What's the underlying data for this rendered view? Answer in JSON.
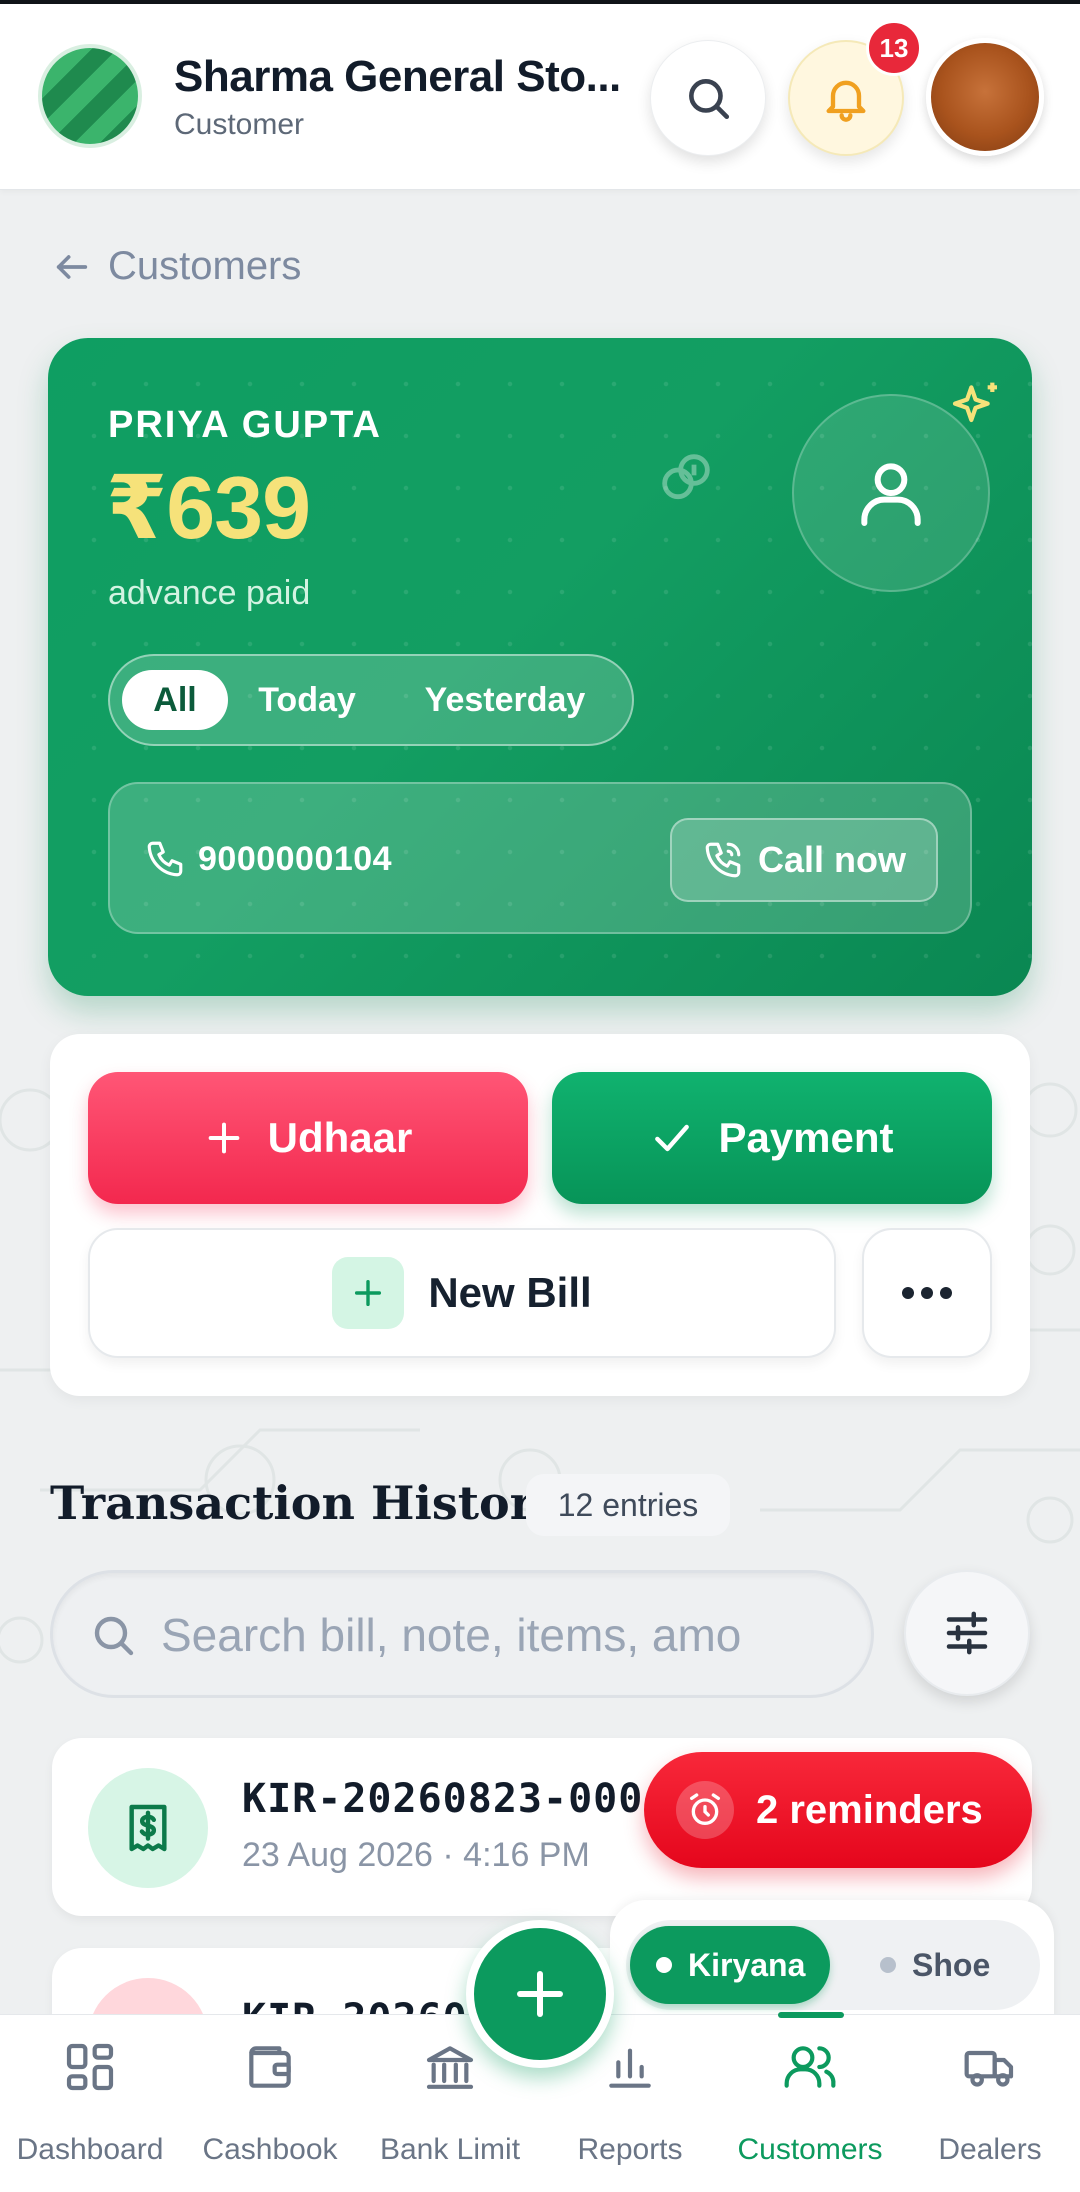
{
  "header": {
    "store_name": "Sharma General Sto...",
    "store_role": "Customer",
    "notification_count": "13"
  },
  "breadcrumb": {
    "back_label": "Customers"
  },
  "customer": {
    "name": "PRIYA GUPTA",
    "amount": "₹639",
    "status": "advance paid",
    "filters": [
      "All",
      "Today",
      "Yesterday"
    ],
    "active_filter": "All",
    "phone": "9000000104",
    "call_label": "Call now"
  },
  "actions": {
    "udhaar_label": "Udhaar",
    "payment_label": "Payment",
    "new_bill_label": "New Bill"
  },
  "history": {
    "title": "Transaction History",
    "count": "12 entries",
    "search_placeholder": "Search bill, note, items, amo",
    "transactions": [
      {
        "id": "KIR-20260823-000",
        "date": "23 Aug 2026 · 4:16 PM"
      },
      {
        "id": "KIR-20260"
      }
    ]
  },
  "reminders": {
    "label": "2 reminders"
  },
  "shops": {
    "active": "Kiryana",
    "inactive": "Shoe"
  },
  "nav": {
    "items": [
      "Dashboard",
      "Cashbook",
      "Bank Limit",
      "Reports",
      "Customers",
      "Dealers"
    ],
    "active": "Customers"
  },
  "colors": {
    "brand_green": "#0c9a5e",
    "udhaar_red": "#f3284e",
    "amount_yellow": "#f6e27a",
    "badge_red": "#e8283a"
  }
}
